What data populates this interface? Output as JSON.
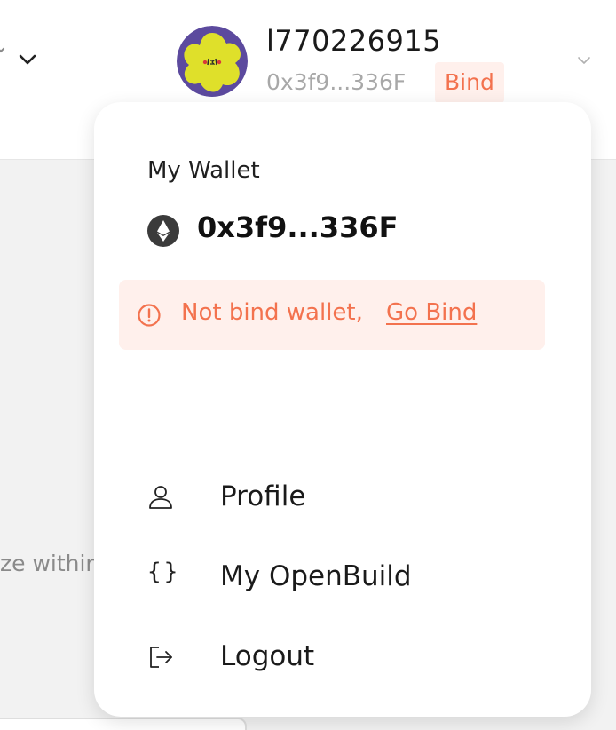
{
  "header": {
    "username": "l770226915",
    "address_short": "0x3f9...336F",
    "bind_label": "Bind"
  },
  "background": {
    "partial_text": "ze within"
  },
  "dropdown": {
    "wallet_label": "My Wallet",
    "wallet_address": "0x3f9...336F",
    "alert": {
      "message": "Not bind wallet,",
      "link_label": "Go Bind"
    },
    "menu": [
      {
        "label": "Profile",
        "icon": "user-icon"
      },
      {
        "label": "My OpenBuild",
        "icon": "braces-icon"
      },
      {
        "label": "Logout",
        "icon": "logout-icon"
      }
    ]
  },
  "colors": {
    "accent": "#f3724e",
    "accent_bg": "#fff0ec",
    "avatar_yellow": "#dfe02a",
    "avatar_purple": "#5c4a9e"
  }
}
